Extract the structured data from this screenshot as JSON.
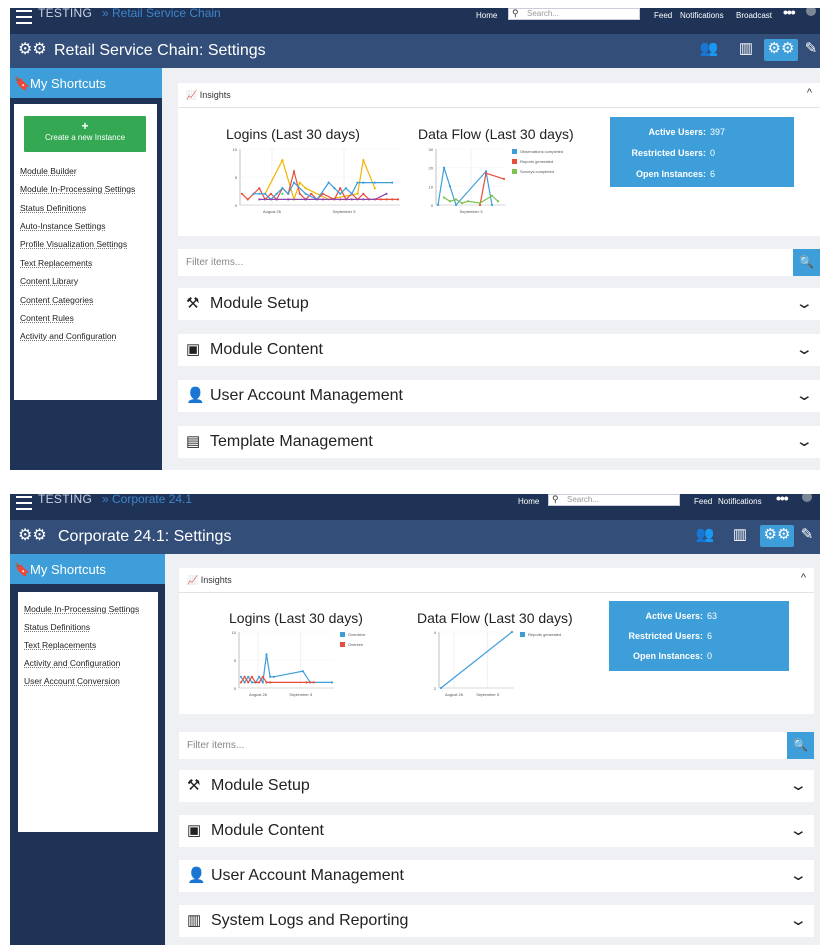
{
  "screens": [
    {
      "topnav": {
        "app": "TESTING",
        "crumb": "» Retail Service Chain",
        "home": "Home",
        "search_placeholder": "Search...",
        "links": [
          "Feed",
          "Notifications",
          "Broadcast"
        ]
      },
      "title": "Retail Service Chain: Settings",
      "shortcuts": {
        "heading": "My Shortcuts",
        "create_plus": "+",
        "create_label": "Create a new Instance",
        "items": [
          "Module Builder",
          "Module In-Processing Settings",
          "Status Definitions",
          "Auto-Instance Settings",
          "Profile Visualization Settings",
          "Text Replacements",
          "Content Library",
          "Content Categories",
          "Content Rules",
          "Activity and Configuration"
        ]
      },
      "insights": {
        "label": "Insights",
        "caret": "^"
      },
      "charts": [
        {
          "chart_data": {
            "type": "line",
            "title": "Logins (Last 30 days)",
            "xlabel": "",
            "ylabel": "",
            "ylim": [
              0,
              10
            ],
            "yticks": [
              "10",
              "5",
              "0"
            ],
            "xticks": [
              "August 26",
              "September 5"
            ],
            "x": [
              1,
              2,
              3,
              4,
              5,
              6,
              7,
              8,
              9,
              10,
              11,
              12,
              13,
              14,
              15,
              16,
              17,
              18,
              19,
              20,
              21,
              22,
              23,
              24,
              25,
              26,
              27,
              28
            ],
            "series": [
              {
                "name": "",
                "color": "#f4b400",
                "values": [
                  null,
                  null,
                  null,
                  null,
                  2,
                  null,
                  null,
                  8,
                  null,
                  1,
                  4,
                  3,
                  null,
                  null,
                  null,
                  1,
                  null,
                  null,
                  null,
                  null,
                  2,
                  8,
                  null,
                  3,
                  null,
                  null,
                  null,
                  null
                ]
              },
              {
                "name": "",
                "color": "#e74c3c",
                "values": [
                  2,
                  1,
                  2,
                  3,
                  1,
                  2,
                  1,
                  3,
                  2,
                  6,
                  2,
                  1,
                  2,
                  1,
                  2,
                  null,
                  1,
                  3,
                  1,
                  2,
                  1,
                  2,
                  1,
                  null,
                  1,
                  1,
                  1,
                  1
                ]
              },
              {
                "name": "",
                "color": "#3d9ed9",
                "values": [
                  null,
                  null,
                  2,
                  2,
                  2,
                  1,
                  2,
                  3,
                  2,
                  4,
                  null,
                  2,
                  null,
                  1,
                  null,
                  4,
                  3,
                  2,
                  3,
                  2,
                  4,
                  4,
                  null,
                  4,
                  null,
                  null,
                  4,
                  null
                ]
              },
              {
                "name": "",
                "color": "#8e44ad",
                "values": [
                  null,
                  null,
                  null,
                  1,
                  null,
                  null,
                  1,
                  null,
                  1,
                  null,
                  null,
                  1,
                  null,
                  null,
                  1,
                  null,
                  null,
                  1,
                  null,
                  1,
                  null,
                  1,
                  null,
                  1,
                  null,
                  2,
                  null,
                  null
                ]
              },
              {
                "name": "",
                "color": "#2ecc71",
                "values": [
                  null,
                  null,
                  null,
                  null,
                  null,
                  null,
                  null,
                  2,
                  null,
                  null,
                  null,
                  null,
                  null,
                  null,
                  null,
                  null,
                  null,
                  null,
                  null,
                  null,
                  null,
                  null,
                  null,
                  null,
                  null,
                  null,
                  null,
                  null
                ]
              }
            ]
          }
        },
        {
          "chart_data": {
            "type": "line",
            "title": "Data Flow (Last 30 days)",
            "xlabel": "",
            "ylabel": "",
            "ylim": [
              0,
              30
            ],
            "yticks": [
              "30",
              "20",
              "10",
              "0"
            ],
            "xticks": [
              "September 3"
            ],
            "legend": "top-right",
            "x": [
              1,
              2,
              3,
              4,
              5,
              6,
              7,
              8,
              9,
              10,
              11,
              12
            ],
            "series": [
              {
                "name": "Observations completed",
                "color": "#3d9ed9",
                "values": [
                  0,
                  20,
                  10,
                  0,
                  null,
                  null,
                  null,
                  null,
                  18,
                  0,
                  null,
                  null
                ]
              },
              {
                "name": "Reports generated",
                "color": "#e74c3c",
                "values": [
                  null,
                  null,
                  null,
                  null,
                  null,
                  null,
                  null,
                  0,
                  17,
                  null,
                  null,
                  14
                ]
              },
              {
                "name": "Surveys completed",
                "color": "#7cc24e",
                "values": [
                  null,
                  4,
                  2,
                  3,
                  1,
                  2,
                  null,
                  1,
                  null,
                  5,
                  2,
                  null
                ]
              }
            ]
          }
        }
      ],
      "stats": [
        {
          "label": "Active Users:",
          "value": "397"
        },
        {
          "label": "Restricted Users:",
          "value": "0"
        },
        {
          "label": "Open Instances:",
          "value": "6"
        }
      ],
      "filter_placeholder": "Filter items...",
      "sections": [
        {
          "label": "Module Setup",
          "icon": "tools-icon"
        },
        {
          "label": "Module Content",
          "icon": "folder-icon"
        },
        {
          "label": "User Account Management",
          "icon": "user-gear-icon"
        },
        {
          "label": "Template Management",
          "icon": "template-icon"
        }
      ]
    },
    {
      "topnav": {
        "app": "TESTING",
        "crumb": "» Corporate 24.1",
        "home": "Home",
        "search_placeholder": "Search...",
        "links": [
          "Feed",
          "Notifications"
        ]
      },
      "title": "Corporate 24.1: Settings",
      "shortcuts": {
        "heading": "My Shortcuts",
        "items": [
          "Module In-Processing Settings",
          "Status Definitions",
          "Text Replacements",
          "Activity and Configuration",
          "User Account Conversion"
        ]
      },
      "insights": {
        "label": "Insights",
        "caret": "^"
      },
      "charts": [
        {
          "chart_data": {
            "type": "line",
            "title": "Logins (Last 30 days)",
            "xlabel": "",
            "ylabel": "",
            "ylim": [
              0,
              10
            ],
            "yticks": [
              "10",
              "5",
              "0"
            ],
            "xticks": [
              "August 26",
              "September 5"
            ],
            "legend": "top-right",
            "x": [
              1,
              2,
              3,
              4,
              5,
              6,
              7,
              8,
              9,
              10,
              11,
              12,
              13,
              14,
              15,
              16,
              17,
              18,
              19,
              20,
              21,
              22,
              23,
              24,
              25,
              26
            ],
            "series": [
              {
                "name": "Overdrive",
                "color": "#3d9ed9",
                "values": [
                  2,
                  1,
                  2,
                  1,
                  1,
                  2,
                  1,
                  6,
                  2,
                  2,
                  null,
                  null,
                  null,
                  null,
                  null,
                  null,
                  null,
                  3,
                  null,
                  1,
                  null,
                  null,
                  null,
                  null,
                  null,
                  1
                ]
              },
              {
                "name": "Oversee",
                "color": "#e74c3c",
                "values": [
                  1,
                  2,
                  1,
                  2,
                  1,
                  1,
                  2,
                  1,
                  1,
                  null,
                  null,
                  null,
                  null,
                  null,
                  null,
                  null,
                  null,
                  null,
                  1,
                  null,
                  1,
                  null,
                  null,
                  null,
                  null,
                  null
                ]
              }
            ]
          }
        },
        {
          "chart_data": {
            "type": "line",
            "title": "Data Flow (Last 30 days)",
            "xlabel": "",
            "ylabel": "",
            "ylim": [
              2,
              4
            ],
            "yticks": [
              "4",
              "2"
            ],
            "xticks": [
              "August 26",
              "September 5"
            ],
            "legend": "top-right",
            "x": [
              1,
              10
            ],
            "series": [
              {
                "name": "Reports generated",
                "color": "#3d9ed9",
                "values": [
                  2,
                  4
                ]
              }
            ]
          }
        }
      ],
      "stats": [
        {
          "label": "Active Users:",
          "value": "63"
        },
        {
          "label": "Restricted Users:",
          "value": "6"
        },
        {
          "label": "Open Instances:",
          "value": "0"
        }
      ],
      "filter_placeholder": "Filter items...",
      "sections": [
        {
          "label": "Module Setup",
          "icon": "tools-icon"
        },
        {
          "label": "Module Content",
          "icon": "folder-icon"
        },
        {
          "label": "User Account Management",
          "icon": "user-gear-icon"
        },
        {
          "label": "System Logs and Reporting",
          "icon": "bar-chart-icon"
        }
      ]
    }
  ]
}
